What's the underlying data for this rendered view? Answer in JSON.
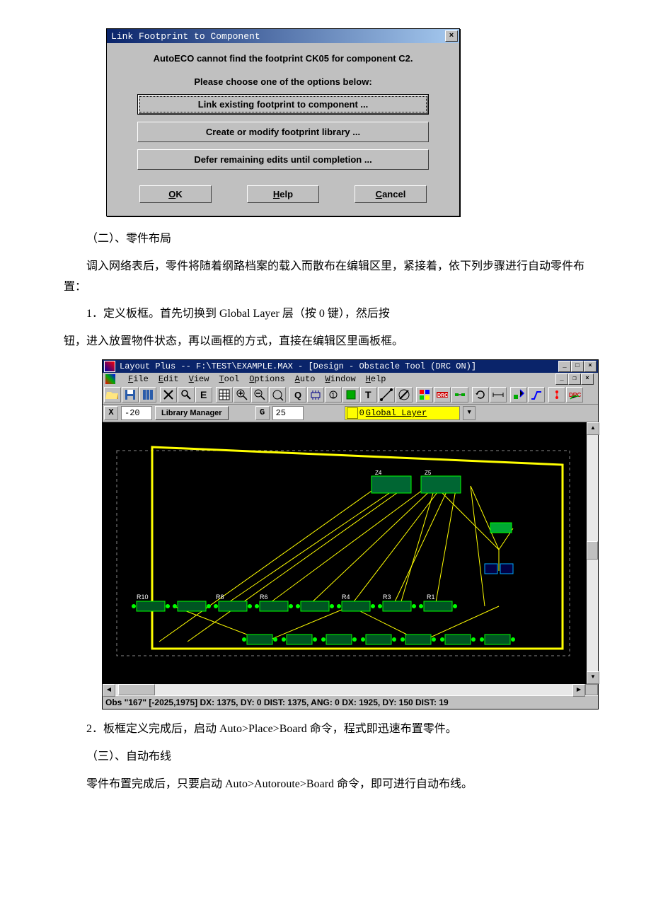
{
  "dialog1": {
    "title": "Link Footprint to Component",
    "msg1": "AutoECO cannot find the footprint CK05 for component C2.",
    "msg2": "Please choose one of the options below:",
    "opt1": "Link existing footprint to component ...",
    "opt2": "Create or modify footprint library ...",
    "opt3": "Defer remaining edits until completion ...",
    "ok_prefix": "O",
    "ok_rest": "K",
    "help_prefix": "H",
    "help_rest": "elp",
    "cancel_prefix": "C",
    "cancel_rest": "ancel"
  },
  "text": {
    "sec2": "（二）、零件布局",
    "p1": "调入网络表后，零件将随着纲路档案的载入而散布在编辑区里，紧接着，依下列步骤进行自动零件布置：",
    "step1": "1．定义板框。首先切换到 Global Layer 层（按 0 键），然后按",
    "step1b": "钮，进入放置物件状态，再以画框的方式，直接在编辑区里画板框。",
    "step2": "2．板框定义完成后，启动 Auto>Place>Board 命令，程式即迅速布置零件。",
    "sec3": "（三）、自动布线",
    "p3": "零件布置完成后，只要启动 Auto>Autoroute>Board 命令，即可进行自动布线。"
  },
  "app": {
    "title": "Layout Plus -- F:\\TEST\\EXAMPLE.MAX - [Design - Obstacle Tool (DRC ON)]",
    "menu": {
      "file_u": "F",
      "file": "ile",
      "edit_u": "E",
      "edit": "dit",
      "view_u": "V",
      "view": "iew",
      "tool_u": "T",
      "tool": "ool",
      "options_u": "O",
      "options": "ptions",
      "auto_u": "A",
      "auto": "uto",
      "window_u": "W",
      "window": "indow",
      "help_u": "H",
      "help": "elp"
    },
    "coord": {
      "x_label": "X",
      "x_value": "-20",
      "lib_mgr": "Library Manager",
      "g_label": "G",
      "g_value": "25",
      "layer_idx": "0",
      "layer_name": "Global Layer"
    },
    "status": "Obs \"167\" [-2025,1975]   DX: 1375, DY: 0  DIST: 1375, ANG: 0     DX: 1925, DY: 150  DIST: 19"
  }
}
